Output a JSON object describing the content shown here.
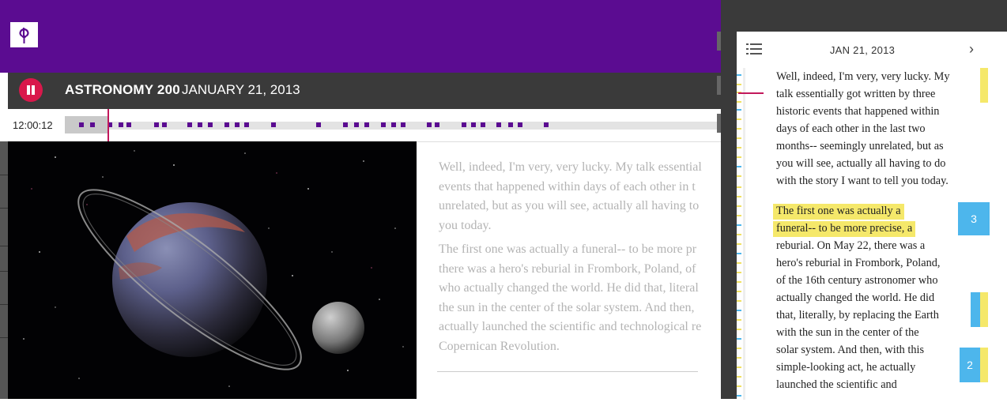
{
  "header": {
    "logo_icon": "torch-icon",
    "brand_color": "#5b0c91"
  },
  "player": {
    "course": "ASTRONOMY 200",
    "date": "JANUARY 21, 2013",
    "time": "12:00:12",
    "pause_icon": "pause-icon",
    "accent_color": "#d9184b"
  },
  "transcript": {
    "paragraphs": [
      [
        "Well, indeed, I'm very, very lucky. My talk essential",
        "events that happened within days of each other in t",
        "unrelated, but as you will see, actually all having to",
        "you today."
      ],
      [
        "The first one was actually a funeral-- to be more pr",
        "there was a hero's reburial in Frombork, Poland, of",
        "who actually changed the world. He did that, literal",
        "the sun in the center of the solar system. And then,",
        "actually launched the scientific and technological re",
        "Copernican Revolution."
      ]
    ]
  },
  "notes": {
    "date": "JAN 21, 2013",
    "list_icon": "list-icon",
    "next_icon": "chevron-right-icon",
    "p1": [
      "Well, indeed, I'm very, very lucky. My",
      "talk essentially got written by three",
      "historic events that happened within",
      "days of each other in the last two",
      "months-- seemingly unrelated, but as",
      "you will see, actually all having to do",
      "with the story I want to tell you today."
    ],
    "p2_highlight": [
      "The first one was actually a",
      "funeral-- to be more precise, a"
    ],
    "p2": [
      "reburial. On May 22, there was a",
      "hero's reburial in Frombork, Poland,",
      "of the 16th century astronomer who",
      "actually changed the world. He did",
      "that, literally, by replacing the Earth",
      "with the sun in the center of the",
      "solar system. And then, with this",
      "simple-looking act, he actually",
      "launched the scientific and"
    ],
    "badges": [
      {
        "label": "3"
      },
      {
        "label": ""
      },
      {
        "label": "2"
      }
    ],
    "highlight_color": "#f5e86a",
    "badge_color": "#4db6ec"
  }
}
